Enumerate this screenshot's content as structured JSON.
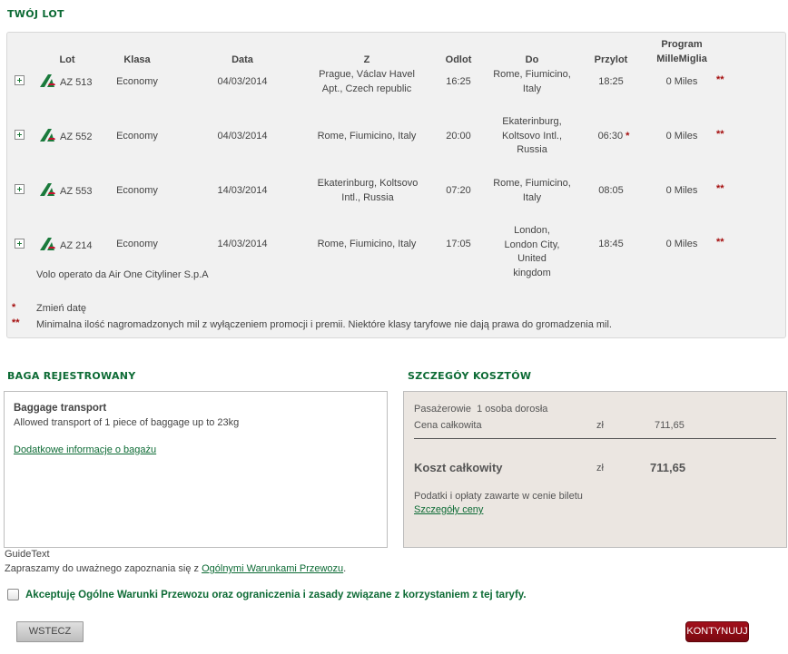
{
  "flight_section": {
    "title": "TWÓJ LOT",
    "headers": {
      "flight": "Lot",
      "class": "Klasa",
      "date": "Data",
      "from": "Z",
      "departure": "Odlot",
      "to": "Do",
      "arrival": "Przylot",
      "program_line1": "Program",
      "program_line2": "MilleMiglia"
    },
    "rows": [
      {
        "flight": "AZ 513",
        "class": "Economy",
        "date": "04/03/2014",
        "from": "Prague, Václav Havel Apt., Czech republic",
        "departure": "16:25",
        "to": "Rome, Fiumicino, Italy",
        "arrival": "18:25",
        "arrival_mark": "",
        "miles": "0 Miles",
        "mark": "**"
      },
      {
        "flight": "AZ 552",
        "class": "Economy",
        "date": "04/03/2014",
        "from": "Rome, Fiumicino, Italy",
        "departure": "20:00",
        "to": "Ekaterinburg, Koltsovo Intl., Russia",
        "arrival": "06:30",
        "arrival_mark": "*",
        "miles": "0 Miles",
        "mark": "**"
      },
      {
        "flight": "AZ 553",
        "class": "Economy",
        "date": "14/03/2014",
        "from": "Ekaterinburg, Koltsovo Intl., Russia",
        "departure": "07:20",
        "to": "Rome, Fiumicino, Italy",
        "arrival": "08:05",
        "arrival_mark": "",
        "miles": "0 Miles",
        "mark": "**"
      },
      {
        "flight": "AZ 214",
        "class": "Economy",
        "date": "14/03/2014",
        "from": "Rome, Fiumicino, Italy",
        "departure": "17:05",
        "to": "London, London City, United kingdom",
        "arrival": "18:45",
        "arrival_mark": "",
        "miles": "0 Miles",
        "mark": "**"
      }
    ],
    "operated_by": "Volo operato da Air One Cityliner S.p.A",
    "notes": [
      {
        "marker": "*",
        "text": "Zmień datę"
      },
      {
        "marker": "**",
        "text": "Minimalna ilość nagromadzonych mil z wyłączeniem promocji i premii. Niektóre klasy taryfowe nie dają prawa do gromadzenia mil."
      }
    ]
  },
  "baggage_section": {
    "title": "BAGA REJESTROWANY",
    "heading": "Baggage transport",
    "description": "Allowed transport of 1 piece of baggage up to 23kg",
    "link": "Dodatkowe informacje o bagażu"
  },
  "cost_section": {
    "title": "SZCZEGÓY KOSZTÓW",
    "passengers_label": "Pasażerowie",
    "passengers_value": "1 osoba dorosła",
    "total_price_label": "Cena całkowita",
    "currency": "zł",
    "total_price_value": "711,65",
    "total_cost_label": "Koszt całkowity",
    "total_cost_value": "711,65",
    "taxes_note": "Podatki i opłaty zawarte w cenie biletu",
    "details_link": "Szczegóły ceny"
  },
  "guide": {
    "label": "GuideText",
    "text_prefix": "Zapraszamy do uważnego zapoznania się z ",
    "link": "Ogólnymi Warunkami Przewozu",
    "text_suffix": "."
  },
  "terms": {
    "checkbox_label": "Akceptuję Ogólne Warunki Przewozu oraz ograniczenia i zasady związane z korzystaniem z tej taryfy."
  },
  "buttons": {
    "back": "WSTECZ",
    "continue": "KONTYNUUJ"
  },
  "colors": {
    "brand_green": "#0d6b35",
    "accent_red": "#a50e0e",
    "continue_button": "#8b0a14"
  }
}
